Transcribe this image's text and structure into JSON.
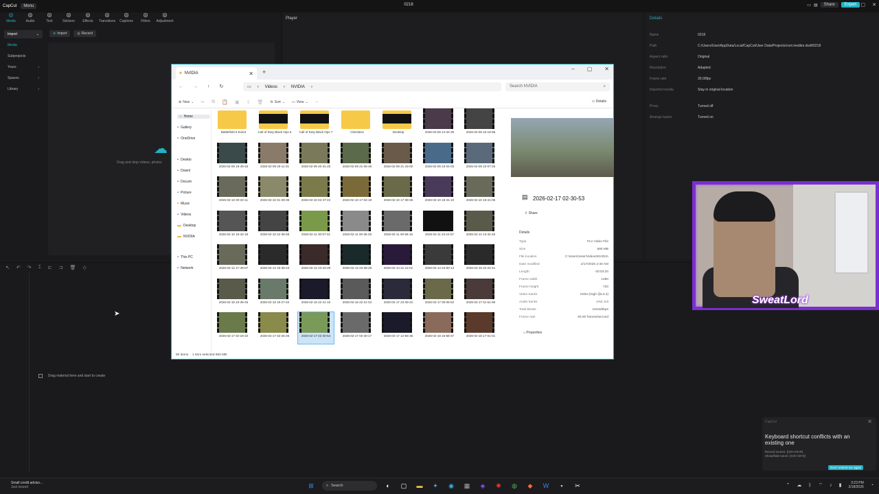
{
  "capcut": {
    "logo": "CapCut",
    "menu": "Menu",
    "title": "0218",
    "share": "Share",
    "export": "Export",
    "tools": [
      {
        "label": "Media",
        "icon": "media-icon"
      },
      {
        "label": "Audio",
        "icon": "audio-icon"
      },
      {
        "label": "Text",
        "icon": "text-icon"
      },
      {
        "label": "Stickers",
        "icon": "stickers-icon"
      },
      {
        "label": "Effects",
        "icon": "effects-icon"
      },
      {
        "label": "Transitions",
        "icon": "transitions-icon"
      },
      {
        "label": "Captions",
        "icon": "captions-icon"
      },
      {
        "label": "Filters",
        "icon": "filters-icon"
      },
      {
        "label": "Adjustment",
        "icon": "adjustment-icon"
      }
    ],
    "nav": [
      "Import",
      "Media",
      "Subprojects",
      "Yours",
      "Spaces",
      "Library"
    ],
    "import_btn": "Import",
    "record_btn": "Record",
    "drop_hint": "Drag and drop videos, photos",
    "player_title": "Player",
    "details_title": "Details",
    "details": [
      {
        "k": "Name",
        "v": "0218"
      },
      {
        "k": "Path",
        "v": "C:/Users/User/AppData/Local/CapCut/User Data/Projects/com.lveditor.draft/0218"
      },
      {
        "k": "Aspect ratio",
        "v": "Original"
      },
      {
        "k": "Resolution",
        "v": "Adapted"
      },
      {
        "k": "Frame rate",
        "v": "30.00fps"
      },
      {
        "k": "Imported media",
        "v": "Stay in original location"
      },
      {
        "k": "Proxy",
        "v": "Turned off"
      },
      {
        "k": "Arrange layers",
        "v": "Turned on"
      }
    ],
    "timeline_hint": "Drag material here and start to create"
  },
  "notification": {
    "app": "CapCut",
    "title": "Keyboard shortcut conflicts with an existing one",
    "line1": "Record screen: [Ctrl+Alt+R]",
    "line2": "Show/hide tutors: [Ctrl+Alt+E]",
    "button": "Don't remind me again"
  },
  "explorer": {
    "tab": "NVIDIA",
    "path": [
      "Videos",
      "NVIDIA"
    ],
    "search_placeholder": "Search NVIDIA",
    "cmd": {
      "new": "New",
      "sort": "Sort",
      "view": "View",
      "details": "Details"
    },
    "sidebar": [
      {
        "label": "Home",
        "icon": "home-icon",
        "sel": true
      },
      {
        "label": "Gallery",
        "icon": "gallery-icon"
      },
      {
        "label": "OneDrive",
        "icon": "cloud-icon"
      },
      {
        "label": "Deskto",
        "icon": "desktop-icon"
      },
      {
        "label": "Downl",
        "icon": "download-icon"
      },
      {
        "label": "Docum",
        "icon": "document-icon"
      },
      {
        "label": "Picture",
        "icon": "picture-icon"
      },
      {
        "label": "Music",
        "icon": "music-icon"
      },
      {
        "label": "Videos",
        "icon": "video-icon"
      },
      {
        "label": "Desktop",
        "icon": "folder-icon"
      },
      {
        "label": "NVIDIA",
        "icon": "folder-icon"
      },
      {
        "label": "This PC",
        "icon": "pc-icon"
      },
      {
        "label": "Network",
        "icon": "network-icon"
      }
    ],
    "items": [
      {
        "name": "Battlefield 6 Event",
        "type": "folder"
      },
      {
        "name": "Call of Duty Black Ops 6",
        "type": "folder-dark"
      },
      {
        "name": "Call of Duty Black Ops 7",
        "type": "folder-dark"
      },
      {
        "name": "Clientless",
        "type": "folder"
      },
      {
        "name": "Desktop",
        "type": "folder-dark"
      },
      {
        "name": "2026-02-09 14-34-35",
        "type": "video",
        "c": "#4a3a4a"
      },
      {
        "name": "2026-02-09 15-19-58",
        "type": "video",
        "c": "#444"
      },
      {
        "name": "2026-02-09 19-49-15",
        "type": "video",
        "c": "#3a4a4a"
      },
      {
        "name": "2026-02-09 20-11-31",
        "type": "video",
        "c": "#8a7a6a"
      },
      {
        "name": "2026-02-09 20-31-25",
        "type": "video",
        "c": "#7a7a5a"
      },
      {
        "name": "2026-02-09 21-05-48",
        "type": "video",
        "c": "#5a6a4a"
      },
      {
        "name": "2026-02-09 21-19-00",
        "type": "video",
        "c": "#6a5a4a"
      },
      {
        "name": "2026-02-09 23-04-03",
        "type": "video",
        "c": "#4a6a8a"
      },
      {
        "name": "2026-02-09 23-07-25",
        "type": "video",
        "c": "#5a6a7a"
      },
      {
        "name": "2026-02-10 00-22-11",
        "type": "video",
        "c": "#6a6a5a"
      },
      {
        "name": "2026-02-10 01-39-35",
        "type": "video",
        "c": "#8a8a6a"
      },
      {
        "name": "2026-02-10 02-47-22",
        "type": "video",
        "c": "#7a7a4a"
      },
      {
        "name": "2026-02-10 17-04-19",
        "type": "video",
        "c": "#7a6a3a"
      },
      {
        "name": "2026-02-10 17-39-35",
        "type": "video",
        "c": "#6a6a4a"
      },
      {
        "name": "2026-02-10 18-31-10",
        "type": "video",
        "c": "#4a3a5a"
      },
      {
        "name": "2026-02-10 19-41-06",
        "type": "video",
        "c": "#6a6a5a"
      },
      {
        "name": "2026-02-10 19-42-18",
        "type": "video",
        "c": "#555"
      },
      {
        "name": "2026-02-10 22-38-58",
        "type": "video",
        "c": "#444"
      },
      {
        "name": "2026-02-11 00-07-01",
        "type": "video",
        "c": "#7a9a4a"
      },
      {
        "name": "2026-02-11 00-36-29",
        "type": "video",
        "c": "#8a8a8a"
      },
      {
        "name": "2026-02-11 00-58-15",
        "type": "video",
        "c": "#6a6a6a"
      },
      {
        "name": "2026-02-11 23-24-57",
        "type": "video",
        "c": "#111"
      },
      {
        "name": "2026-02-12 13-32-46",
        "type": "video",
        "c": "#5a5a4a"
      },
      {
        "name": "2026-02-12 17-49-07",
        "type": "video",
        "c": "#6a6a5a"
      },
      {
        "name": "2026-02-12 19-38-43",
        "type": "video",
        "c": "#2a2a2a"
      },
      {
        "name": "2026-02-12 23-23-28",
        "type": "video",
        "c": "#3a2a2a"
      },
      {
        "name": "2026-02-13 23-38-28",
        "type": "video",
        "c": "#1a2a2a"
      },
      {
        "name": "2026-02-14 21-12-01",
        "type": "video",
        "c": "#2a1a3a"
      },
      {
        "name": "2026-02-14 23-50-13",
        "type": "video",
        "c": "#3a3a3a"
      },
      {
        "name": "2026-02-15 22-24-41",
        "type": "video",
        "c": "#2a2a2a"
      },
      {
        "name": "2026-02-15 23-39-45",
        "type": "video",
        "c": "#5a5a4a"
      },
      {
        "name": "2026-02-16 19-27-40",
        "type": "video",
        "c": "#6a7a6a"
      },
      {
        "name": "2026-02-16 22-41-16",
        "type": "video",
        "c": "#1a1a2a"
      },
      {
        "name": "2026-02-16 22-21-04",
        "type": "video",
        "c": "#5a5a5a"
      },
      {
        "name": "2026-02-17 23-39-22",
        "type": "video",
        "c": "#2a2a3a"
      },
      {
        "name": "2026-02-17 00-05-52",
        "type": "video",
        "c": "#6a6a4a"
      },
      {
        "name": "2026-02-17 01-51-59",
        "type": "video",
        "c": "#4a3a3a"
      },
      {
        "name": "2026-02-17 02-19-10",
        "type": "video",
        "c": "#6a7a4a"
      },
      {
        "name": "2026-02-17 02-25-25",
        "type": "video",
        "c": "#8a8a4a"
      },
      {
        "name": "2026-02-17 02-30-53",
        "type": "video",
        "c": "#7a9a5a",
        "sel": true
      },
      {
        "name": "2026-02-17 02-40-17",
        "type": "video",
        "c": "#6a6a6a"
      },
      {
        "name": "2026-02-17 12-56-35",
        "type": "video",
        "c": "#1a1a2a"
      },
      {
        "name": "2026-02-18 16-58-37",
        "type": "video",
        "c": "#8a6a5a"
      },
      {
        "name": "2026-02-18 17-01-01",
        "type": "video",
        "c": "#5a3a2a"
      }
    ],
    "selected_title": "2026-02-17 02-30-53",
    "share_label": "Share",
    "details_head": "Details",
    "props": [
      {
        "k": "Type",
        "v": "FLV Video File"
      },
      {
        "k": "Size",
        "v": "690 MB"
      },
      {
        "k": "File location",
        "v": "C:\\Users\\User\\Videos\\NVIDIA"
      },
      {
        "k": "Date modified",
        "v": "2/17/2026 2:40 AM"
      },
      {
        "k": "Length",
        "v": "00:03:20"
      },
      {
        "k": "Frame width",
        "v": "1280"
      },
      {
        "k": "Frame height",
        "v": "720"
      },
      {
        "k": "Video tracks",
        "v": "H264 (High @L3.2)"
      },
      {
        "k": "Audio tracks",
        "v": "AAC 2.0"
      },
      {
        "k": "Total bitrate",
        "v": "10342kbps"
      },
      {
        "k": "Frame rate",
        "v": "60.00 frames/second"
      }
    ],
    "properties_label": "Properties",
    "status_count": "50 items",
    "status_sel": "1 item selected  690 MB"
  },
  "webcam": {
    "label": "SweatLord"
  },
  "taskbar": {
    "weather_title": "Small credit adviso...",
    "weather_sub": "Just issued",
    "search": "Search",
    "time": "3:23 PM",
    "date": "2/18/2026"
  }
}
